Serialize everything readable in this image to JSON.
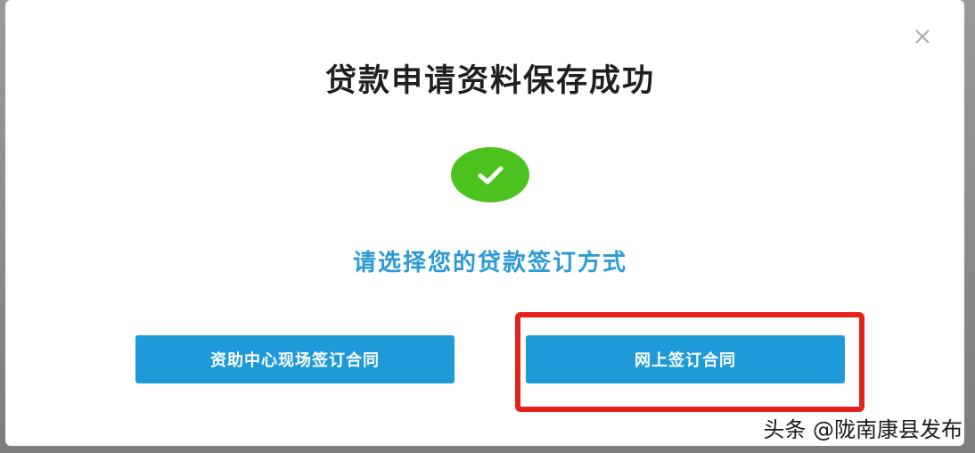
{
  "dialog": {
    "title": "贷款申请资料保存成功",
    "subtitle": "请选择您的贷款签订方式",
    "close_icon": "close-icon",
    "success_icon": "check-circle-icon"
  },
  "buttons": {
    "offline_label": "资助中心现场签订合同",
    "online_label": "网上签订合同"
  },
  "watermark": "头条 @陇南康县发布",
  "colors": {
    "accent": "#1f9ad8",
    "success": "#4cc21f",
    "highlight": "#e8201a",
    "subtitle": "#2b9ad6"
  }
}
